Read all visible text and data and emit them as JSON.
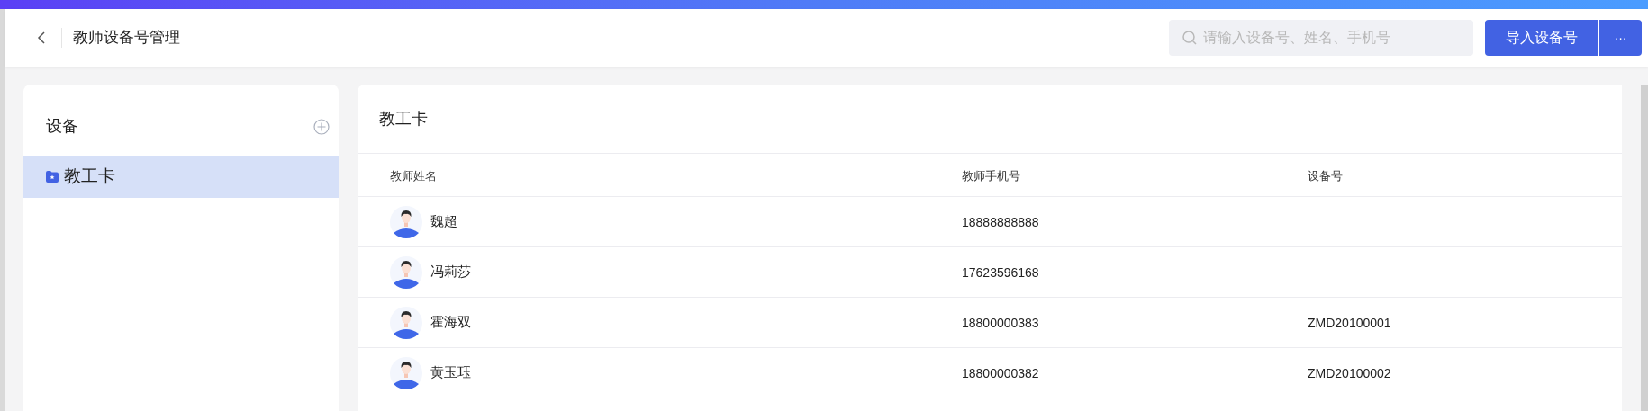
{
  "header": {
    "title": "教师设备号管理",
    "search": {
      "placeholder": "请输入设备号、姓名、手机号"
    },
    "import_button": "导入设备号",
    "more_button": "···"
  },
  "sidebar": {
    "title": "设备",
    "items": [
      {
        "label": "教工卡",
        "selected": true
      }
    ]
  },
  "table": {
    "title": "教工卡",
    "columns": [
      "教师姓名",
      "教师手机号",
      "设备号"
    ],
    "rows": [
      {
        "name": "魏超",
        "phone": "18888888888"
      },
      {
        "name": "冯莉莎",
        "phone": "17623596168"
      },
      {
        "name": "霍海双",
        "phone": "18800000383",
        "device": "ZMD20100001"
      },
      {
        "name": "黄玉珏",
        "phone": "18800000382",
        "device": "ZMD20100002"
      }
    ]
  }
}
